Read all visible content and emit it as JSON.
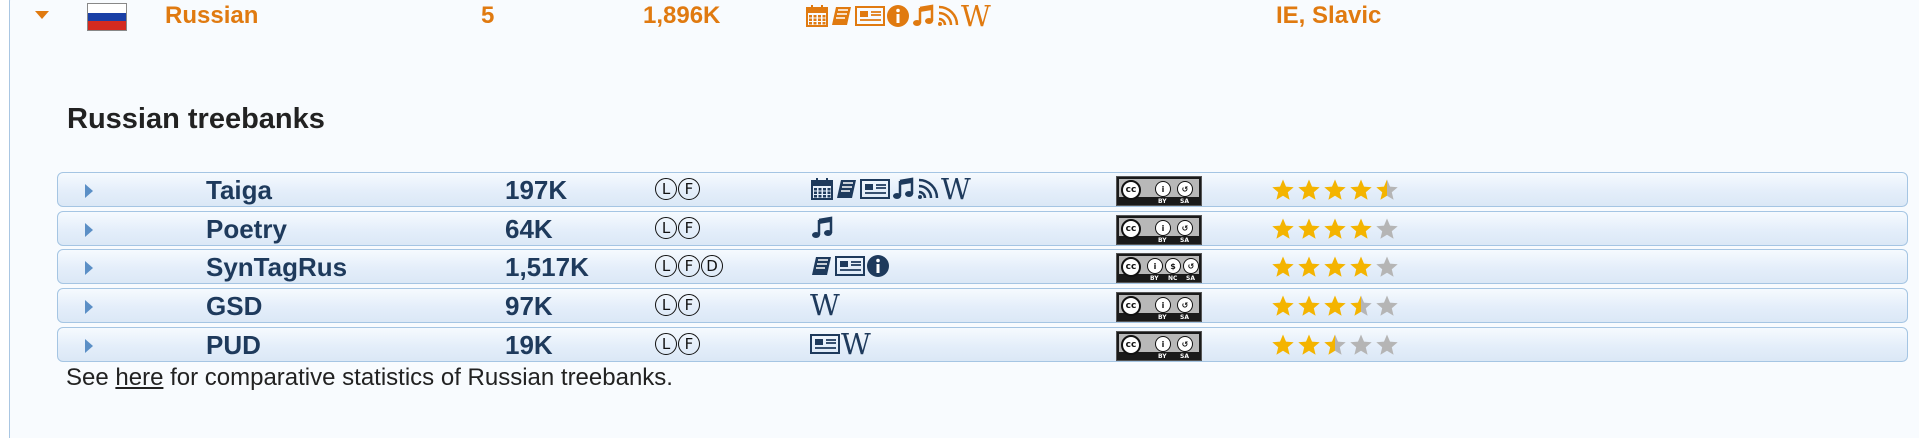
{
  "language": {
    "name": "Russian",
    "treebank_count": "5",
    "size": "1,896K",
    "genres": [
      "calendar-icon",
      "book-icon",
      "newspaper-icon",
      "info-icon",
      "music-icon",
      "speech-icon",
      "wikipedia-icon"
    ],
    "family": "IE, Slavic",
    "colors": {
      "accent": "#e07a10",
      "row_text": "#1e3a5c"
    }
  },
  "section": {
    "title": "Russian treebanks"
  },
  "treebanks": [
    {
      "name": "Taiga",
      "size": "197K",
      "annotations": [
        "L",
        "F"
      ],
      "genres": [
        "calendar",
        "book",
        "newspaper",
        "music",
        "speech",
        "wiki"
      ],
      "license": "CC BY-SA",
      "rating": 4.5
    },
    {
      "name": "Poetry",
      "size": "64K",
      "annotations": [
        "L",
        "F"
      ],
      "genres": [
        "music"
      ],
      "license": "CC BY-SA",
      "rating": 4
    },
    {
      "name": "SynTagRus",
      "size": "1,517K",
      "annotations": [
        "L",
        "F",
        "D"
      ],
      "genres": [
        "book",
        "newspaper",
        "info"
      ],
      "license": "CC BY-NC-SA",
      "rating": 4
    },
    {
      "name": "GSD",
      "size": "97K",
      "annotations": [
        "L",
        "F"
      ],
      "genres": [
        "wiki"
      ],
      "license": "CC BY-SA",
      "rating": 3.5
    },
    {
      "name": "PUD",
      "size": "19K",
      "annotations": [
        "L",
        "F"
      ],
      "genres": [
        "newspaper",
        "wiki"
      ],
      "license": "CC BY-SA",
      "rating": 2.5
    }
  ],
  "license_text": {
    "cc": "cc",
    "by": "BY",
    "nc": "NC",
    "sa": "SA"
  },
  "footer": {
    "prefix": "See ",
    "link": "here",
    "suffix": " for comparative statistics of Russian treebanks."
  },
  "wiki_glyph": "W"
}
